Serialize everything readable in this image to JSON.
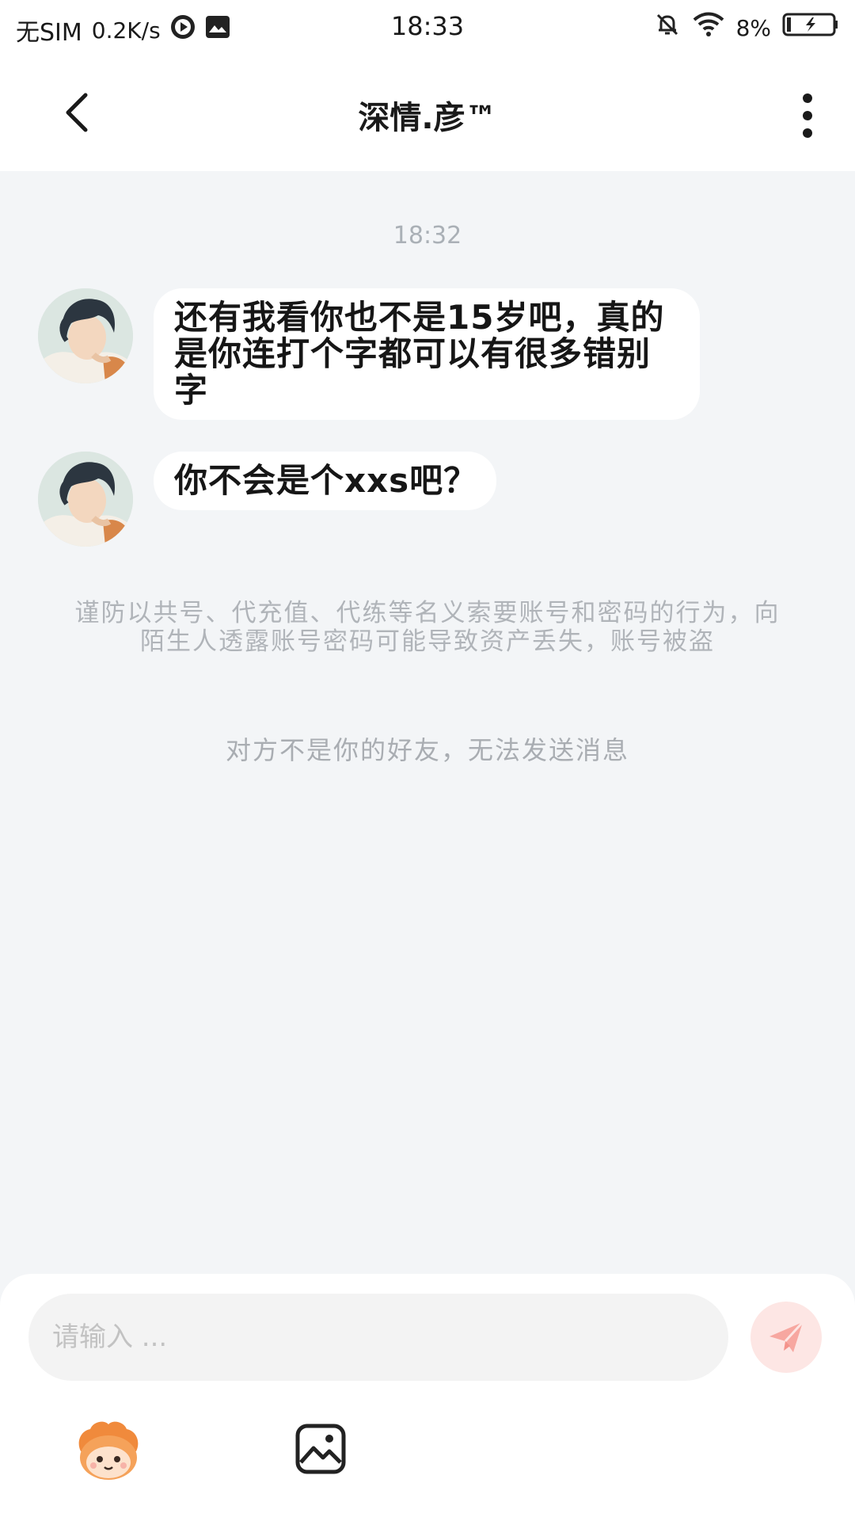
{
  "status_bar": {
    "carrier": "无SIM",
    "net_speed": "0.2K/s",
    "time": "18:33",
    "battery": "8%"
  },
  "header": {
    "title": "深情.彦™"
  },
  "chat": {
    "timestamp": "18:32",
    "messages": [
      {
        "text": "还有我看你也不是15岁吧，真的是你连打个字都可以有很多错别字"
      },
      {
        "text": "你不会是个xxs吧？"
      }
    ],
    "safety_notice": "谨防以共号、代充值、代练等名义索要账号和密码的行为，向陌生人透露账号密码可能导致资产丢失，账号被盗",
    "status_note": "对方不是你的好友，无法发送消息"
  },
  "composer": {
    "placeholder": "请输入 ..."
  },
  "colors": {
    "background": "#f3f5f7",
    "bubble": "#ffffff",
    "send_button": "#fde6e4",
    "send_icon": "#f7a7a0"
  }
}
